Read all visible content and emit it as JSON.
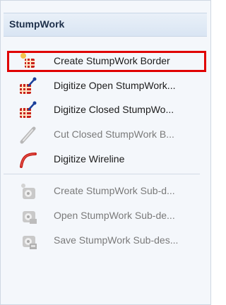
{
  "header": {
    "title": "StumpWork"
  },
  "items": [
    {
      "label": "Create StumpWork Border",
      "icon": "create-stumpwork-border-icon",
      "enabled": true,
      "selected": true
    },
    {
      "label": "Digitize Open StumpWork...",
      "icon": "digitize-open-stumpwork-icon",
      "enabled": true,
      "selected": false
    },
    {
      "label": "Digitize Closed StumpWo...",
      "icon": "digitize-closed-stumpwork-icon",
      "enabled": true,
      "selected": false
    },
    {
      "label": "Cut Closed StumpWork B...",
      "icon": "cut-closed-stumpwork-icon",
      "enabled": false,
      "selected": false
    },
    {
      "label": "Digitize Wireline",
      "icon": "digitize-wireline-icon",
      "enabled": true,
      "selected": false
    },
    {
      "label": "Create StumpWork Sub-d...",
      "icon": "create-stumpwork-subdesign-icon",
      "enabled": false,
      "selected": false
    },
    {
      "label": "Open StumpWork Sub-de...",
      "icon": "open-stumpwork-subdesign-icon",
      "enabled": false,
      "selected": false
    },
    {
      "label": "Save StumpWork Sub-des...",
      "icon": "save-stumpwork-subdesign-icon",
      "enabled": false,
      "selected": false
    }
  ],
  "colors": {
    "selection_outline": "#e00000",
    "accent_red": "#c8201a",
    "disabled_text": "#7a7a7a"
  }
}
